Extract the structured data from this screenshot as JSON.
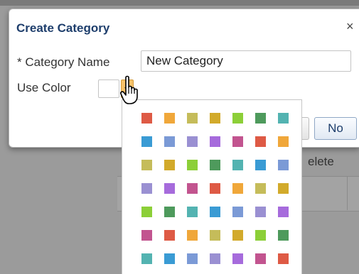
{
  "dialog": {
    "title": "Create Category",
    "close_symbol": "×",
    "name_label_star": "*",
    "name_label": "Category Name",
    "name_value": "New Category",
    "color_label": "Use Color",
    "no_button": "No"
  },
  "background": {
    "delete_text": "elete"
  },
  "icons": {
    "close": "close-icon",
    "dropdown": "chevron-down-icon",
    "pointer": "hand-pointer-icon"
  },
  "palette": {
    "rows": [
      [
        "#de5a45",
        "#f0a73a",
        "#c5bc5a",
        "#d2aa2b",
        "#8ccf38",
        "#4e9a5c",
        "#53b3b1"
      ],
      [
        "#3a9bd4",
        "#7b9ad6",
        "#9a90d2",
        "#a66bdc",
        "#c2548f",
        "#de5a45",
        "#f0a73a"
      ],
      [
        "#c5bc5a",
        "#d2aa2b",
        "#8ccf38",
        "#4e9a5c",
        "#53b3b1",
        "#3a9bd4",
        "#7b9ad6"
      ],
      [
        "#9a90d2",
        "#a66bdc",
        "#c2548f",
        "#de5a45",
        "#f0a73a",
        "#c5bc5a",
        "#d2aa2b"
      ],
      [
        "#8ccf38",
        "#4e9a5c",
        "#53b3b1",
        "#3a9bd4",
        "#7b9ad6",
        "#9a90d2",
        "#a66bdc"
      ],
      [
        "#c2548f",
        "#de5a45",
        "#f0a73a",
        "#c5bc5a",
        "#d2aa2b",
        "#8ccf38",
        "#4e9a5c"
      ],
      [
        "#53b3b1",
        "#3a9bd4",
        "#7b9ad6",
        "#9a90d2",
        "#a66bdc",
        "#c2548f",
        "#de5a45"
      ]
    ]
  },
  "colors": {
    "title": "#1e3e6c",
    "dropdown_button": "#f7c26a",
    "dialog_bg": "#ffffff",
    "overlay": "#9b9b9b"
  }
}
